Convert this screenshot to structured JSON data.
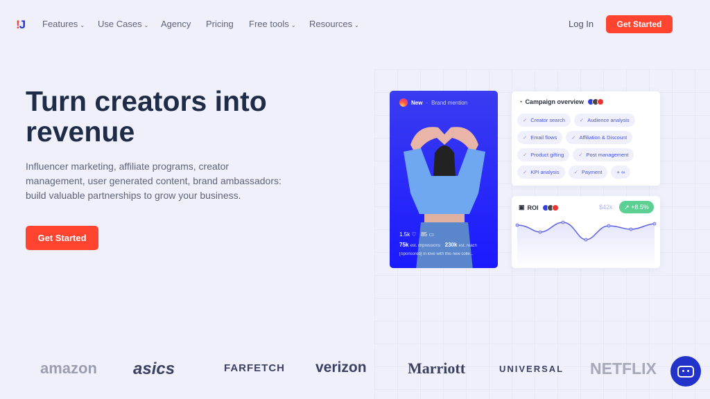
{
  "nav": {
    "logo": "IJ",
    "items": [
      {
        "label": "Features",
        "dropdown": true
      },
      {
        "label": "Use Cases",
        "dropdown": true
      },
      {
        "label": "Agency"
      },
      {
        "label": "Pricing"
      },
      {
        "label": "Free tools",
        "dropdown": true
      },
      {
        "label": "Resources",
        "dropdown": true
      }
    ],
    "login": "Log In",
    "cta": "Get Started"
  },
  "hero": {
    "title": "Turn creators into revenue",
    "subtitle": "Influencer marketing, affiliate programs, creator management, user generated content, brand ambassadors: build valuable partnerships to grow your business.",
    "cta": "Get Started"
  },
  "post": {
    "badge": "New",
    "type": "Brand mention",
    "likes": "1.5k",
    "comments": "85",
    "impressions": "75k",
    "impressions_label": "est. impressions",
    "reach": "230k",
    "reach_label": "est. reach",
    "caption": "[Sponsored] In love with this new colle..."
  },
  "campaign": {
    "title": "Campaign overview",
    "chips": [
      "Creator search",
      "Audience analysis",
      "Email flows",
      "Affiliation & Discount",
      "Product gifting",
      "Post management",
      "KPI analysis",
      "Payment"
    ],
    "more": "+ ∞"
  },
  "roi": {
    "title": "ROI",
    "amount": "$42k",
    "change": "+8.5%"
  },
  "logos": [
    "amazon",
    "asics",
    "FARFETCH",
    "verizon",
    "Marriott",
    "UNIVERSAL",
    "NETFLIX"
  ],
  "colors": {
    "accent": "#ff4430",
    "brand": "#2233dd",
    "positive": "#5ccf93"
  }
}
